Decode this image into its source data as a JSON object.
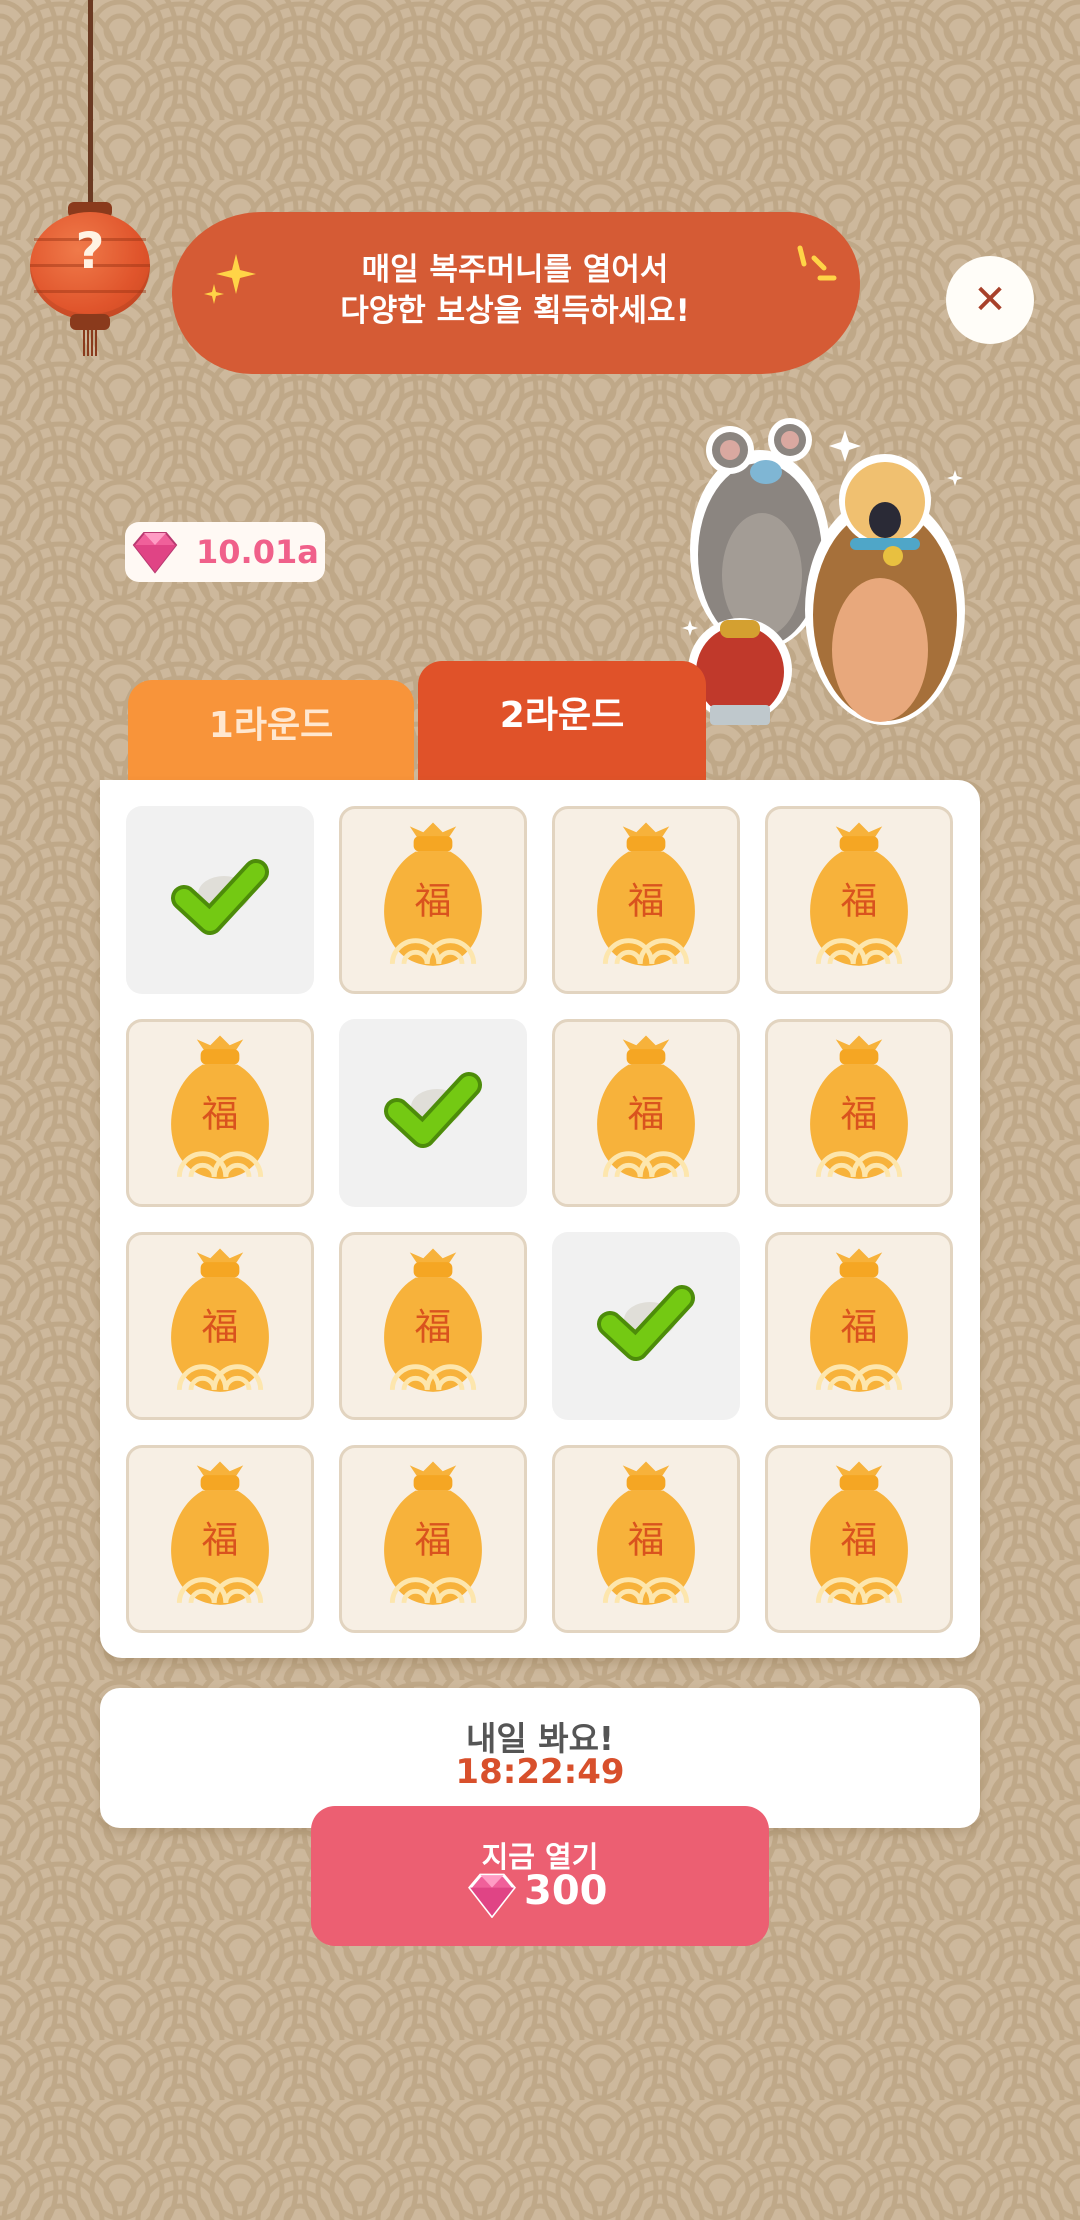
{
  "banner": {
    "line1": "매일 복주머니를 열어서",
    "line2": "다양한 보상을 획득하세요!"
  },
  "lantern": {
    "icon": "question-mark-icon",
    "symbol": "?"
  },
  "close_button": {
    "icon": "close-icon",
    "symbol": "✕"
  },
  "currency": {
    "icon": "gem-icon",
    "value": "10.01a",
    "color": "#f0608a"
  },
  "tabs": [
    {
      "label": "1라운드",
      "selected": false
    },
    {
      "label": "2라운드",
      "selected": true
    }
  ],
  "grid": {
    "bag_symbol": "福",
    "rows": 4,
    "cols": 4,
    "opened_cells": [
      0,
      5,
      10
    ]
  },
  "timer": {
    "label": "내일 봐요!",
    "value": "18:22:49"
  },
  "open_button": {
    "label": "지금 열기",
    "cost": "300",
    "icon": "gem-icon"
  },
  "colors": {
    "accent": "#e05229",
    "tab_inactive": "#f8943a",
    "button": "#ec5f72",
    "check": "#74c913",
    "bag": "#f7b23b"
  }
}
